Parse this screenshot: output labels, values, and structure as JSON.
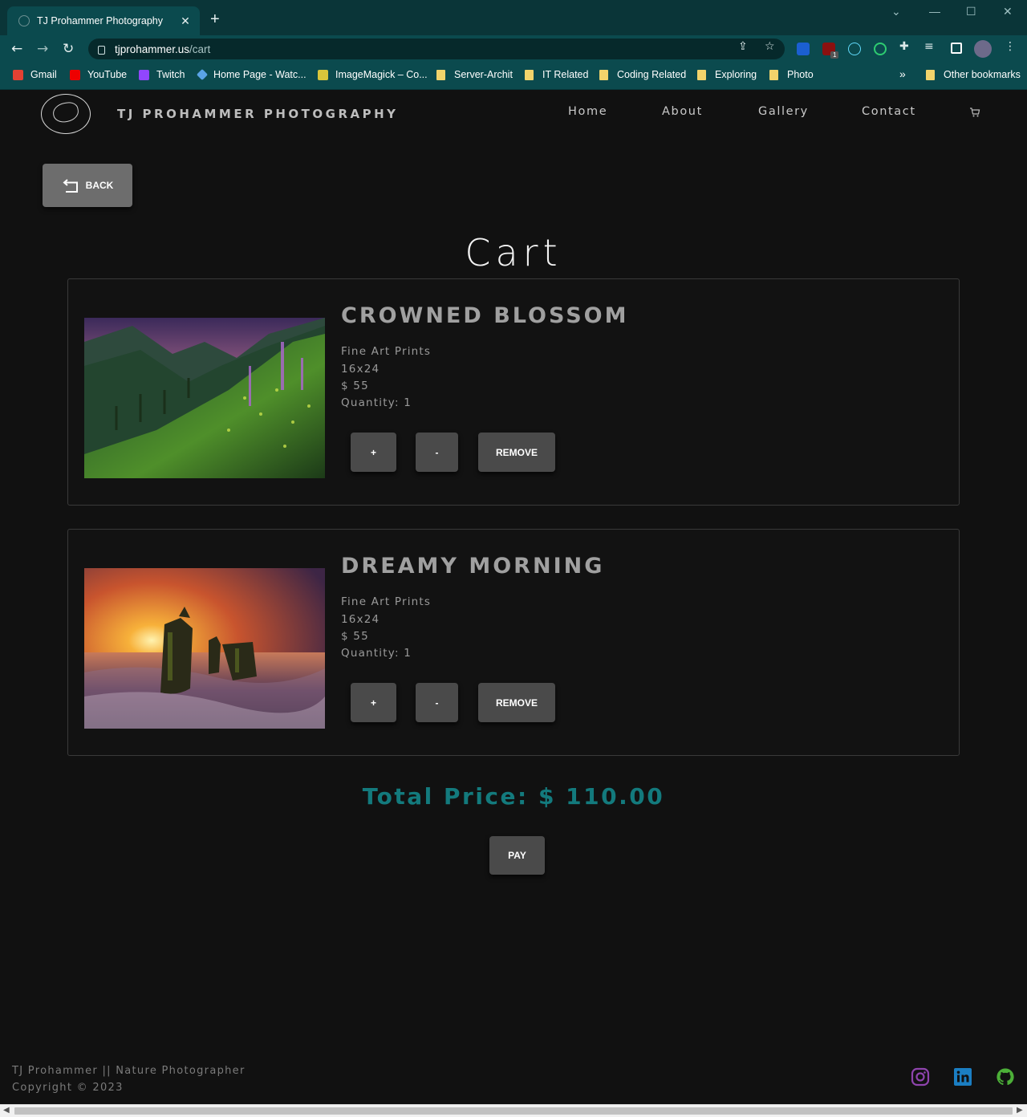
{
  "browser": {
    "tab_title": "TJ Prohammer Photography",
    "tab_close": "✕",
    "new_tab": "+",
    "url_host": "tjprohammer.us",
    "url_path": "/cart",
    "ext_badge": "1",
    "bookmarks": [
      {
        "label": "Gmail"
      },
      {
        "label": "YouTube"
      },
      {
        "label": "Twitch"
      },
      {
        "label": "Home Page - Watc..."
      },
      {
        "label": "ImageMagick – Co..."
      },
      {
        "label": "Server-Archit"
      },
      {
        "label": "IT Related"
      },
      {
        "label": "Coding Related"
      },
      {
        "label": "Exploring"
      },
      {
        "label": "Photo"
      }
    ],
    "more_bookmarks": "»",
    "other_bookmarks": "Other bookmarks"
  },
  "site": {
    "brand": "TJ PROHAMMER PHOTOGRAPHY",
    "nav": [
      "Home",
      "About",
      "Gallery",
      "Contact"
    ]
  },
  "back_label": "BACK",
  "cart_title": "Cart",
  "items": [
    {
      "name": "CROWNED BLOSSOM",
      "category": "Fine Art Prints",
      "size": "16x24",
      "price": "$ 55",
      "quantity": "Quantity: 1",
      "plus": "+",
      "minus": "-",
      "remove": "REMOVE"
    },
    {
      "name": "DREAMY MORNING",
      "category": "Fine Art Prints",
      "size": "16x24",
      "price": "$ 55",
      "quantity": "Quantity: 1",
      "plus": "+",
      "minus": "-",
      "remove": "REMOVE"
    }
  ],
  "total": "Total Price: $ 110.00",
  "pay_label": "PAY",
  "footer": {
    "line1": "TJ Prohammer || Nature Photographer",
    "line2": "Copyright © 2023"
  },
  "social_icons": [
    "instagram-icon",
    "linkedin-icon",
    "github-icon"
  ],
  "colors": {
    "tab_bar": "#0a3538",
    "toolbar": "#0b4a4e",
    "page_bg": "#111111",
    "total_accent": "#137a7d",
    "button_bg": "#4a4a4a"
  }
}
